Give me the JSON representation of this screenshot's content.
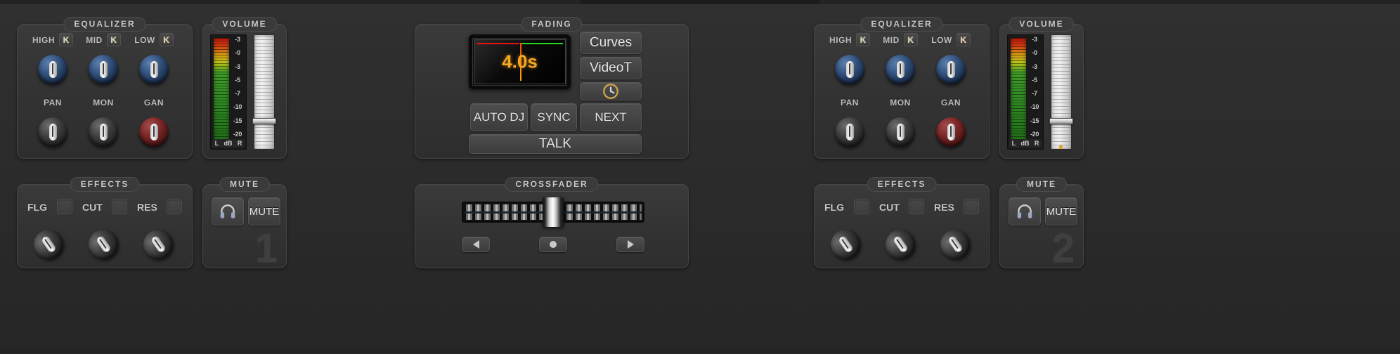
{
  "decks": [
    {
      "id": 1,
      "equalizer": {
        "legend": "EQUALIZER",
        "top_row": [
          {
            "label": "HIGH",
            "k_label": "K",
            "knob_color": "blue",
            "angle": 0
          },
          {
            "label": "MID",
            "k_label": "K",
            "knob_color": "blue",
            "angle": 0
          },
          {
            "label": "LOW",
            "k_label": "K",
            "knob_color": "blue",
            "angle": 0
          }
        ],
        "bottom_row": [
          {
            "label": "PAN",
            "knob_color": "gray",
            "angle": 0
          },
          {
            "label": "MON",
            "knob_color": "gray",
            "angle": 0
          },
          {
            "label": "GAN",
            "knob_color": "red",
            "angle": 0
          }
        ]
      },
      "volume": {
        "legend": "VOLUME",
        "scale": [
          "-3",
          "-0",
          "-3",
          "-5",
          "-7",
          "-10",
          "-15",
          "-20"
        ],
        "foot": [
          "L",
          "dB",
          "R"
        ],
        "fader_position_pct": 74
      },
      "effects": {
        "legend": "EFFECTS",
        "toggles": [
          {
            "label": "FLG",
            "checked": false
          },
          {
            "label": "CUT",
            "checked": false
          },
          {
            "label": "RES",
            "checked": false
          }
        ],
        "knobs": [
          {
            "knob_color": "gray",
            "angle": -35
          },
          {
            "knob_color": "gray",
            "angle": -35
          },
          {
            "knob_color": "gray",
            "angle": -35
          }
        ]
      },
      "mute": {
        "legend": "MUTE",
        "headphone_icon": "headphone-icon",
        "mute_label": "MUTE",
        "deck_number": "1"
      }
    },
    {
      "id": 2,
      "equalizer": {
        "legend": "EQUALIZER",
        "top_row": [
          {
            "label": "HIGH",
            "k_label": "K",
            "knob_color": "blue",
            "angle": 0
          },
          {
            "label": "MID",
            "k_label": "K",
            "knob_color": "blue",
            "angle": 0
          },
          {
            "label": "LOW",
            "k_label": "K",
            "knob_color": "blue",
            "angle": 0
          }
        ],
        "bottom_row": [
          {
            "label": "PAN",
            "knob_color": "gray",
            "angle": 0
          },
          {
            "label": "MON",
            "knob_color": "gray",
            "angle": 0
          },
          {
            "label": "GAN",
            "knob_color": "red",
            "angle": 0
          }
        ]
      },
      "volume": {
        "legend": "VOLUME",
        "scale": [
          "-3",
          "-0",
          "-3",
          "-5",
          "-7",
          "-10",
          "-15",
          "-20"
        ],
        "foot": [
          "L",
          "dB",
          "R"
        ],
        "fader_position_pct": 74
      },
      "effects": {
        "legend": "EFFECTS",
        "toggles": [
          {
            "label": "FLG",
            "checked": false
          },
          {
            "label": "CUT",
            "checked": false
          },
          {
            "label": "RES",
            "checked": false
          }
        ],
        "knobs": [
          {
            "knob_color": "gray",
            "angle": -35
          },
          {
            "knob_color": "gray",
            "angle": -35
          },
          {
            "knob_color": "gray",
            "angle": -35
          }
        ]
      },
      "mute": {
        "legend": "MUTE",
        "headphone_icon": "headphone-icon",
        "mute_label": "MUTE",
        "deck_number": "2"
      }
    }
  ],
  "fading": {
    "legend": "FADING",
    "display_value": "4.0s",
    "curve_left_color": "#ee1111",
    "curve_right_color": "#22dd22",
    "playhead_color": "#ffaa00",
    "side_buttons": [
      {
        "label": "Curves",
        "name": "curves-button"
      },
      {
        "label": "VideoT",
        "name": "videot-button"
      }
    ],
    "timer_button": {
      "icon": "clock-icon",
      "label": ""
    },
    "transport_buttons": [
      {
        "label": "AUTO DJ",
        "name": "auto-dj-button"
      },
      {
        "label": "SYNC",
        "name": "sync-button"
      },
      {
        "label": "NEXT",
        "name": "next-button"
      }
    ],
    "talk_button": {
      "label": "TALK",
      "name": "talk-button"
    }
  },
  "crossfader": {
    "legend": "CROSSFADER",
    "position_pct": 50,
    "controls": [
      {
        "icon": "triangle-left-icon",
        "name": "crossfade-left-button"
      },
      {
        "icon": "dot-icon",
        "name": "crossfade-center-button"
      },
      {
        "icon": "triangle-right-icon",
        "name": "crossfade-right-button"
      }
    ]
  },
  "colors": {
    "background": "#2b2b2b",
    "panel": "#343434",
    "legend_text": "#c9c9c9",
    "accent_orange": "#f5a623",
    "vu_red": "#cc1d10",
    "vu_green": "#3f9a28"
  }
}
